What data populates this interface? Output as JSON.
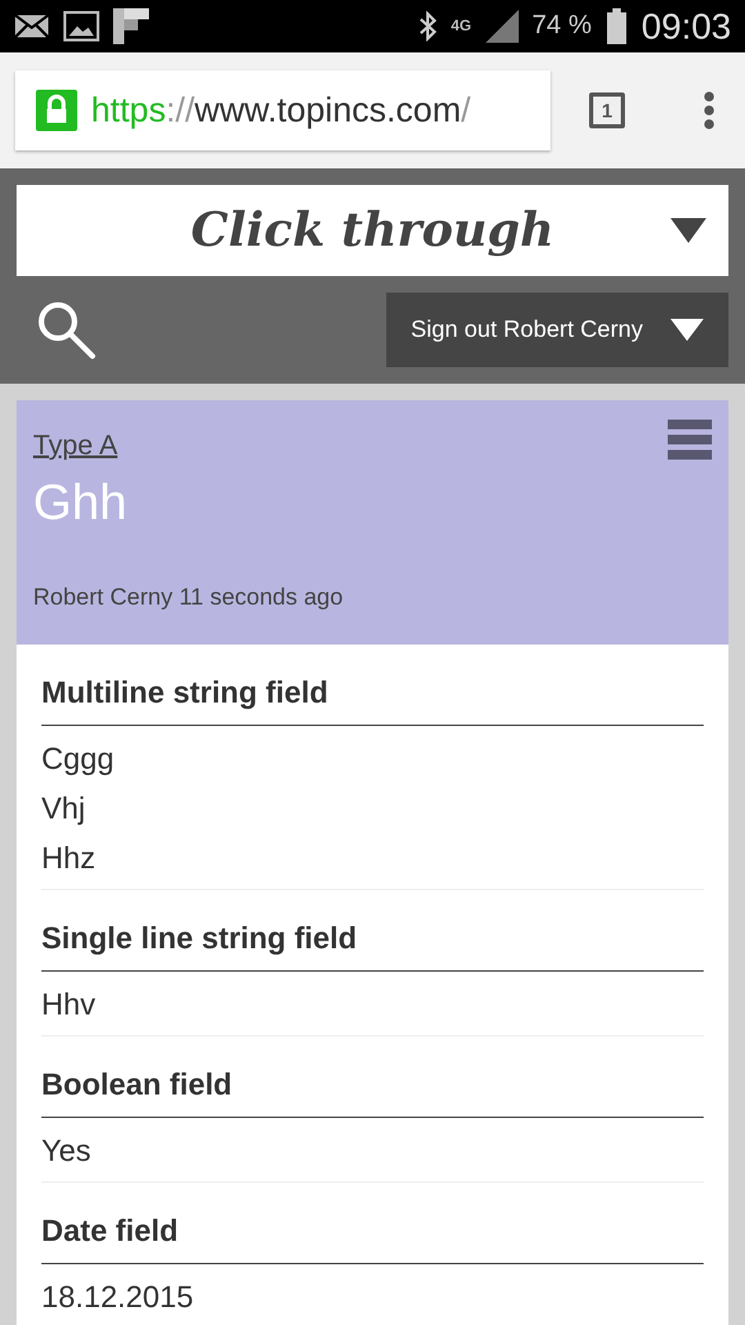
{
  "status_bar": {
    "network": "4G",
    "battery": "74 %",
    "time": "09:03"
  },
  "browser": {
    "url": {
      "scheme": "https",
      "separator": "://",
      "host": "www.topincs.com",
      "path": "/"
    },
    "tab_count": "1"
  },
  "header": {
    "title": "Click through",
    "account_button": "Sign out Robert Cerny"
  },
  "card": {
    "type_link": "Type A",
    "title": "Ghh",
    "meta": "Robert Cerny 11 seconds ago",
    "fields": [
      {
        "label": "Multiline string field",
        "values": [
          "Cggg",
          "Vhj",
          "Hhz"
        ]
      },
      {
        "label": "Single line string field",
        "values": [
          "Hhv"
        ]
      },
      {
        "label": "Boolean field",
        "values": [
          "Yes"
        ]
      },
      {
        "label": "Date field",
        "values": [
          "18.12.2015"
        ]
      }
    ]
  }
}
